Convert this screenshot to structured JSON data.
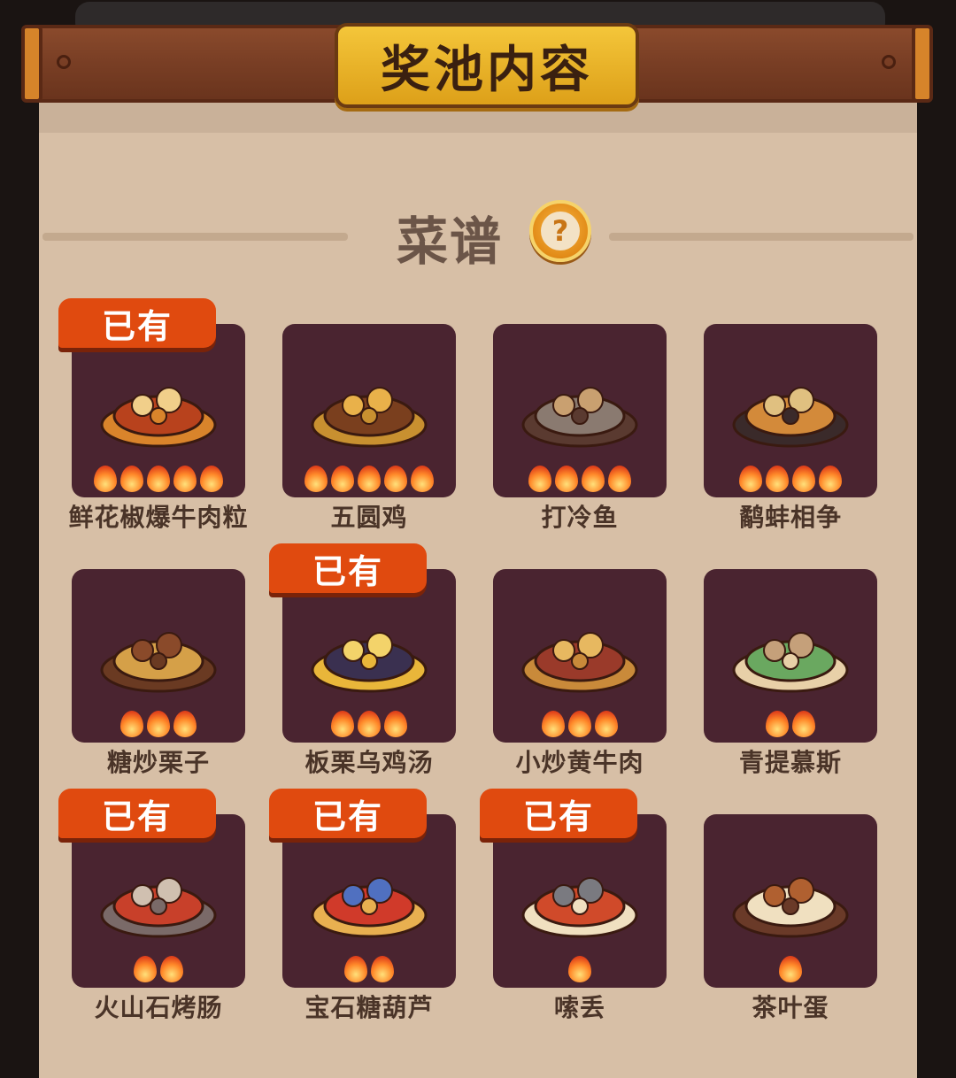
{
  "header": {
    "title": "奖池内容"
  },
  "section": {
    "title": "菜谱",
    "help_icon": "question-icon"
  },
  "owned_label": "已有",
  "recipes": [
    {
      "name": "鲜花椒爆牛肉粒",
      "owned": true,
      "stars": 5
    },
    {
      "name": "五圆鸡",
      "owned": false,
      "stars": 5
    },
    {
      "name": "打冷鱼",
      "owned": false,
      "stars": 4
    },
    {
      "name": "鹬蚌相争",
      "owned": false,
      "stars": 4
    },
    {
      "name": "糖炒栗子",
      "owned": false,
      "stars": 3
    },
    {
      "name": "板栗乌鸡汤",
      "owned": true,
      "stars": 3
    },
    {
      "name": "小炒黄牛肉",
      "owned": false,
      "stars": 3
    },
    {
      "name": "青提慕斯",
      "owned": false,
      "stars": 2
    },
    {
      "name": "火山石烤肠",
      "owned": true,
      "stars": 2
    },
    {
      "name": "宝石糖葫芦",
      "owned": true,
      "stars": 2
    },
    {
      "name": "嗦丢",
      "owned": true,
      "stars": 1
    },
    {
      "name": "茶叶蛋",
      "owned": false,
      "stars": 1
    }
  ],
  "colors": {
    "card_bg": "#4a2430",
    "badge": "#e04a0f",
    "panel": "#d7bfa6",
    "title_plate": "#f4c63a"
  }
}
